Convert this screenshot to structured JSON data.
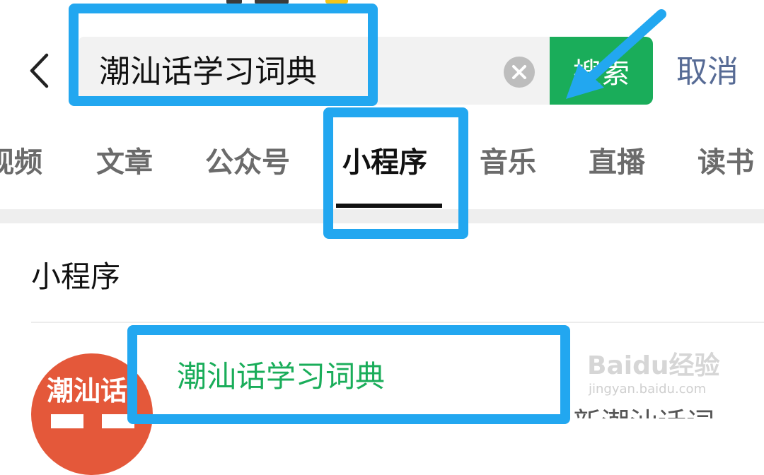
{
  "search": {
    "query": "潮汕话学习词典",
    "button_label": "搜索",
    "cancel_label": "取消"
  },
  "tabs": [
    {
      "label": "视频"
    },
    {
      "label": "文章"
    },
    {
      "label": "公众号"
    },
    {
      "label": "小程序",
      "active": true
    },
    {
      "label": "音乐"
    },
    {
      "label": "直播"
    },
    {
      "label": "读书"
    }
  ],
  "section": {
    "title": "小程序"
  },
  "result": {
    "logo_text": "潮汕话",
    "title": "潮汕话学习词典",
    "description": "新潮汕话词"
  },
  "watermark": {
    "brand": "Baidu经验",
    "url": "jingyan.baidu.com"
  },
  "colors": {
    "accent_green": "#1aad5a",
    "link_blue": "#576b95",
    "annotation_blue": "#22a7f0",
    "logo_red": "#e4583a"
  },
  "icons": {
    "back": "chevron-left-icon",
    "clear": "clear-icon"
  }
}
